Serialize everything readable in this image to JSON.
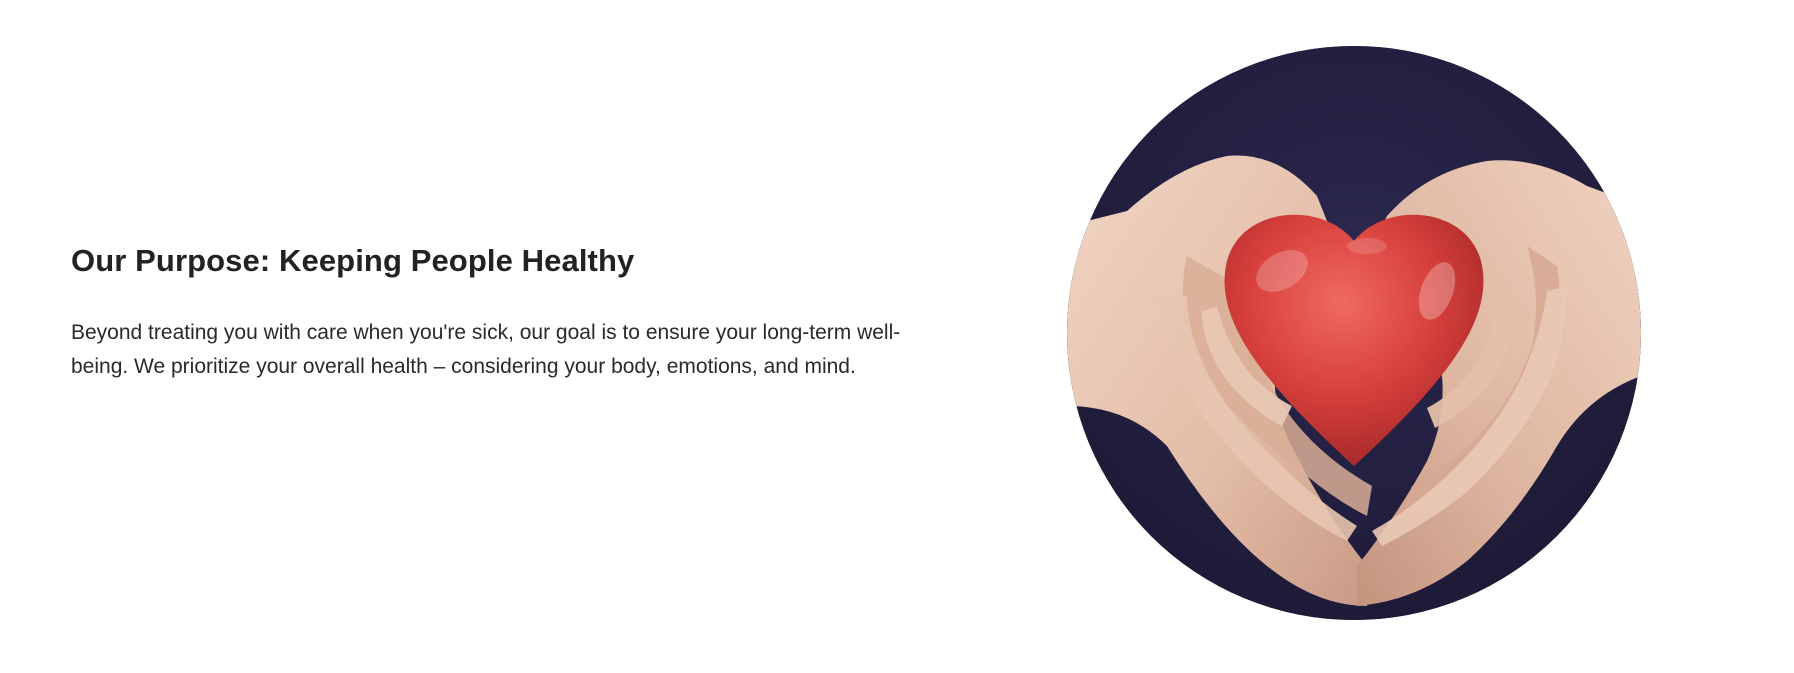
{
  "section": {
    "heading": "Our Purpose: Keeping People Healthy",
    "body": "Beyond treating you with care when you're sick, our goal is to ensure your long-term well-being. We prioritize your overall health – considering your body, emotions, and mind."
  },
  "image": {
    "subject": "hands-holding-heart-icon",
    "colors": {
      "background": "#201d3a",
      "heart": "#d8403c",
      "skin": "#e6c2ad"
    }
  }
}
